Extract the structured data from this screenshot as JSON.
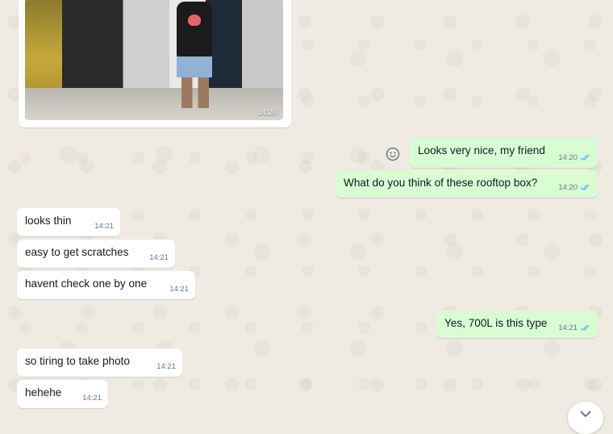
{
  "chat": {
    "image_message": {
      "time": "14:20"
    },
    "messages": [
      {
        "dir": "out",
        "text": "Looks very nice, my friend",
        "time": "14:20"
      },
      {
        "dir": "out",
        "text": "What do you think of these rooftop box?",
        "time": "14:20"
      },
      {
        "dir": "in",
        "text": "looks thin",
        "time": "14:21"
      },
      {
        "dir": "in",
        "text": "easy to get scratches",
        "time": "14:21"
      },
      {
        "dir": "in",
        "text": "havent check one by one",
        "time": "14:21"
      },
      {
        "dir": "out",
        "text": "Yes, 700L is this type",
        "time": "14:21"
      },
      {
        "dir": "in",
        "text": "so tiring to take photo",
        "time": "14:21"
      },
      {
        "dir": "in",
        "text": "hehehe",
        "time": "14:21"
      }
    ]
  },
  "colors": {
    "incoming": "#ffffff",
    "outgoing": "#d9fdd3",
    "read_ticks": "#53bdeb",
    "background": "#efeae2"
  },
  "icons": {
    "emoji": "emoji-smiley-icon",
    "read": "double-check-icon",
    "scroll": "chevron-down-icon"
  }
}
